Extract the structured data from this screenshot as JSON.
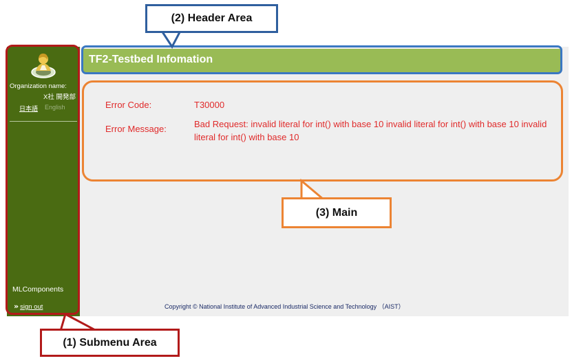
{
  "header": {
    "title": "TF2-Testbed Infomation"
  },
  "sidebar": {
    "organization_label": "Organization name:",
    "organization_value": "X社 開発部",
    "lang_japanese": "日本語",
    "lang_english": "English",
    "app_name": "MLComponents",
    "signout_label": "sign out",
    "signout_icon": "double-chevron-right-icon",
    "logo_icon": "user-avatar-logo-icon"
  },
  "main": {
    "error_code_label": "Error Code:",
    "error_code_value": "T30000",
    "error_message_label": "Error Message:",
    "error_message_value": "Bad Request: invalid literal for int() with base 10 invalid literal for int() with base 10 invalid literal for int() with base 10",
    "error_color": "#e02a2a"
  },
  "footer": {
    "copyright": "Copyright © National Institute of Advanced Industrial Science and Technology （AIST）"
  },
  "annotations": {
    "header_area": "(2) Header Area",
    "main_area": "(3) Main",
    "submenu_area": "(1) Submenu Area"
  },
  "colors": {
    "sidebar_bg": "#4a6b12",
    "header_bg": "#99bb55",
    "content_bg": "#efefef",
    "submenu_outline": "#b21a1a",
    "header_outline": "#3a78c2",
    "main_outline": "#ec8433"
  }
}
